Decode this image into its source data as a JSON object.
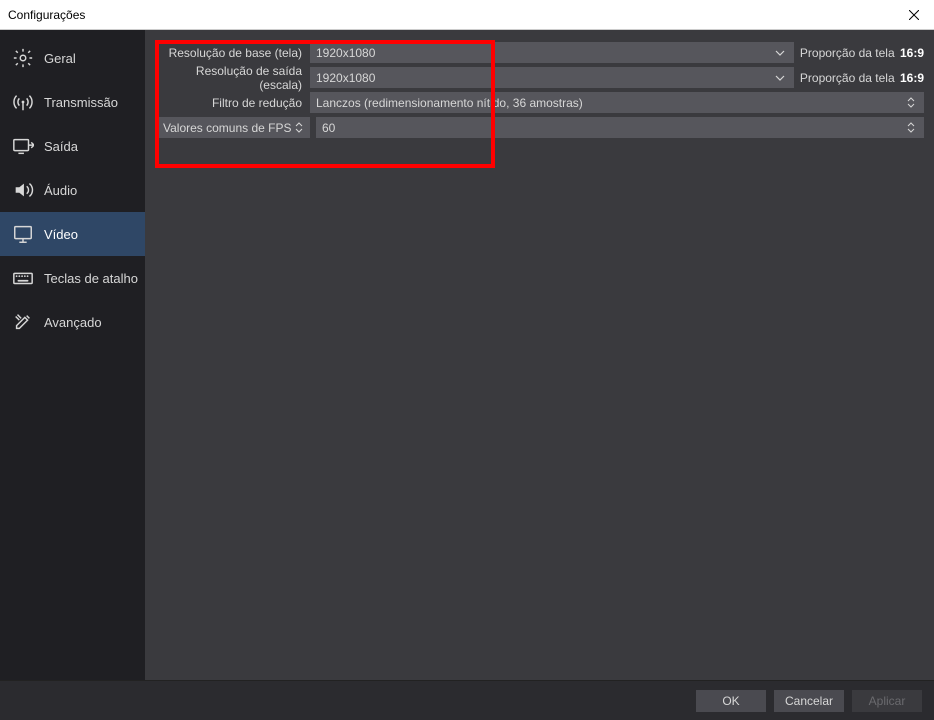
{
  "window": {
    "title": "Configurações"
  },
  "sidebar": {
    "items": [
      {
        "label": "Geral"
      },
      {
        "label": "Transmissão"
      },
      {
        "label": "Saída"
      },
      {
        "label": "Áudio"
      },
      {
        "label": "Vídeo"
      },
      {
        "label": "Teclas de atalho"
      },
      {
        "label": "Avançado"
      }
    ]
  },
  "video": {
    "base_label": "Resolução de base (tela)",
    "base_value": "1920x1080",
    "base_aspect_prefix": "Proporção da tela",
    "base_aspect": "16:9",
    "output_label": "Resolução de saída (escala)",
    "output_value": "1920x1080",
    "output_aspect_prefix": "Proporção da tela",
    "output_aspect": "16:9",
    "filter_label": "Filtro de redução",
    "filter_value": "Lanczos (redimensionamento nítido, 36 amostras)",
    "fps_label": "Valores comuns de FPS",
    "fps_value": "60"
  },
  "footer": {
    "ok": "OK",
    "cancel": "Cancelar",
    "apply": "Aplicar"
  }
}
